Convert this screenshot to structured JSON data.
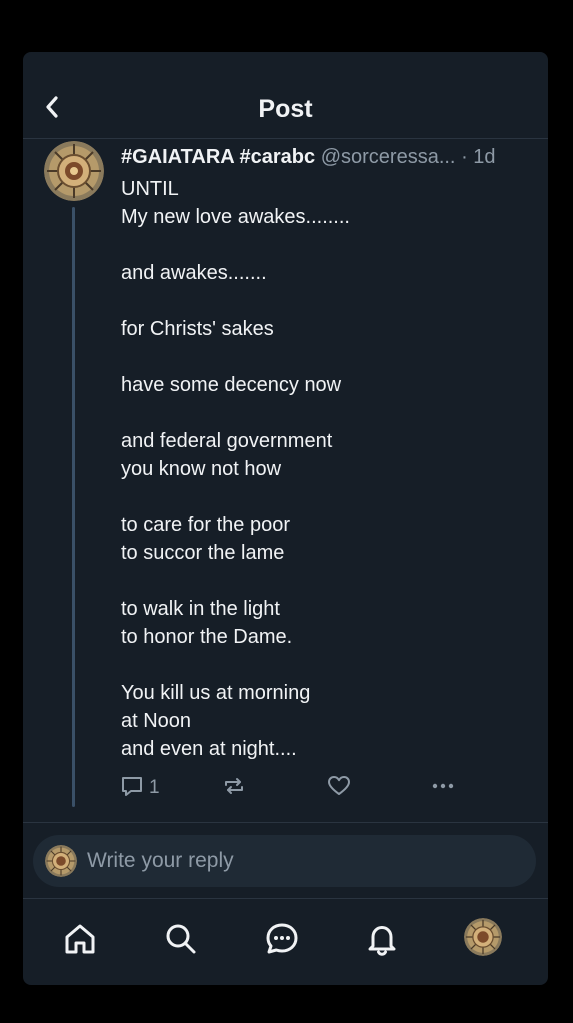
{
  "header": {
    "title": "Post",
    "back_icon": "chevron-left-icon"
  },
  "post": {
    "author": "#GAIATARA #carabc",
    "handle": "@sorceressa...",
    "separator": "·",
    "time": "1d",
    "lines": [
      "UNTIL",
      "My new love awakes........",
      "",
      "and awakes.......",
      "",
      "for Christs' sakes",
      "",
      "have some decency now",
      "",
      "and federal government",
      "you know not how",
      "",
      "to care for the poor",
      "to succor the lame",
      "",
      "to walk in the light",
      "to honor the Dame.",
      "",
      "You kill us at morning",
      "at Noon",
      "and even at night...."
    ],
    "actions": {
      "reply_count": "1",
      "reply_icon": "comment-icon",
      "repost_icon": "repost-icon",
      "like_icon": "heart-icon",
      "more_icon": "more-horizontal-icon"
    }
  },
  "reply_bar": {
    "placeholder": "Write your reply"
  },
  "tabbar": {
    "items": [
      "home-icon",
      "search-icon",
      "chat-icon",
      "bell-icon",
      "profile-avatar"
    ]
  },
  "colors": {
    "background": "#161e27",
    "text": "#f1f3f5",
    "muted": "#8e9aa6",
    "thread_line": "#3a5067"
  }
}
